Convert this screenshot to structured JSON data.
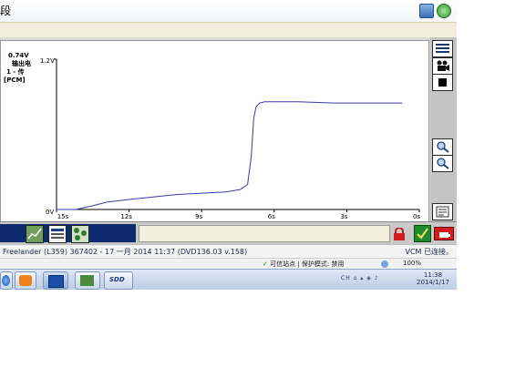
{
  "window": {
    "title_fragment": "段"
  },
  "chart": {
    "y_top_label": "1.2V",
    "y_bottom_label": "0V",
    "legend": {
      "value": "0.74V",
      "line2": "输出电",
      "line3": "1 - 传",
      "line4": "[PCM]"
    },
    "x_ticks": [
      "15s",
      "12s",
      "9s",
      "6s",
      "3s",
      "0s"
    ]
  },
  "chart_data": {
    "type": "line",
    "title": "",
    "xlabel": "",
    "ylabel": "",
    "xlim": [
      15,
      0
    ],
    "ylim": [
      0,
      1.2
    ],
    "grid": false,
    "series": [
      {
        "color": "#3b3ba3",
        "x": [
          15,
          14.2,
          13.5,
          12.9,
          12.0,
          11.0,
          10.0,
          9.0,
          8.0,
          7.4,
          7.1,
          6.95,
          6.85,
          6.75,
          6.6,
          6.4,
          6.0,
          5.0,
          3.5,
          2.5,
          1.5,
          0.7
        ],
        "y": [
          0.0,
          0.0,
          0.03,
          0.06,
          0.08,
          0.1,
          0.12,
          0.13,
          0.14,
          0.16,
          0.2,
          0.42,
          0.72,
          0.82,
          0.85,
          0.86,
          0.86,
          0.86,
          0.85,
          0.85,
          0.85,
          0.85
        ]
      }
    ]
  },
  "info_bar": {
    "left": "Freelander (L359) 367402 - 17 一月 2014 11:37 (DVD136.03 v.158)",
    "right": "VCM 已连接。"
  },
  "ie_status": {
    "zone": "可信站点 | 保护模式: 禁用",
    "zoom": "100%"
  },
  "taskbar": {
    "sdd_label": "SDD",
    "tray_text": "CH ⌂ ▴ ◈ ♪",
    "time": "11:38",
    "date": "2014/1/17"
  },
  "colors": {
    "chart_line": "#3b3ba3",
    "status_blue": "#0d2a6e",
    "vcm_green": "#1f8a2a",
    "battery_red": "#d21d1d"
  },
  "icons": {
    "side_buttons": [
      "list-icon",
      "camera-icon",
      "stop-icon",
      "zoom-in-icon",
      "zoom-out-icon",
      "settings-icon"
    ],
    "status_buttons": [
      "graph-icon",
      "table-icon",
      "network-icon"
    ]
  }
}
